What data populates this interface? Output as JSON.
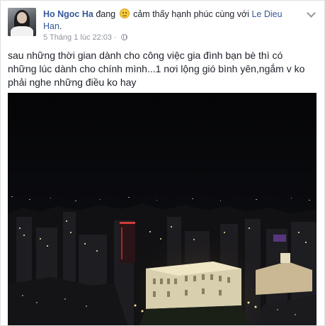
{
  "post": {
    "author": "Ho Ngoc Ha",
    "status_prefix": "đang",
    "feeling_icon": "smiley-icon",
    "feeling_text": "cảm thấy hạnh phúc cùng với",
    "tagged": "Le Dieu Han",
    "tagged_suffix": ".",
    "timestamp": "5 Tháng 1 lúc 22:03",
    "separator": "·",
    "privacy_icon": "globe-icon",
    "menu_icon": "chevron-down-icon",
    "text": "sau những thời gian dành cho công việc gia đình bạn bè thì có những lúc dành cho chính mình...1 nơi lộng gió bình yên,ngắm v ko phải nghe những điều ko hay",
    "photo_icon": "night-city-photo"
  }
}
